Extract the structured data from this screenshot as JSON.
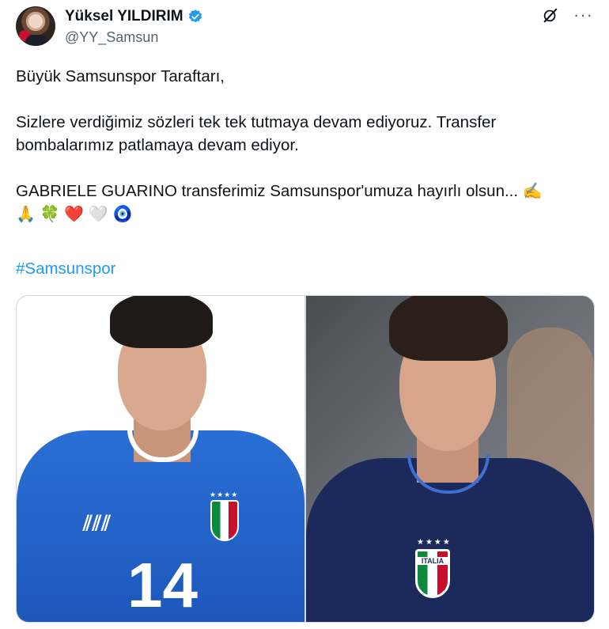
{
  "author": {
    "name": "Yüksel YILDIRIM",
    "handle": "@YY_Samsun",
    "verified": true,
    "avatar_icon": "profile-photo"
  },
  "header_actions": {
    "grok_icon": "grok-icon",
    "more_label": "···"
  },
  "tweet": {
    "line1": "Büyük Samsunspor Taraftarı,",
    "line2": "Sizlere verdiğimiz sözleri tek tek tutmaya devam ediyoruz. Transfer",
    "line3": "bombalarımız patlamaya devam ediyor.",
    "line4": "GABRIELE GUARINO transferimiz Samsunspor'umuza hayırlı olsun... ",
    "line4_emoji": "✍️",
    "line5_emojis": [
      "🙏",
      "🍀",
      "❤️",
      "🤍",
      "🧿"
    ],
    "hashtag": "#Samsunspor"
  },
  "media": {
    "left_photo": {
      "jersey_number": "14",
      "brand_mark": "adidas"
    },
    "right_photo": {
      "crest_label": "ITALIA"
    }
  },
  "colors": {
    "link": "#1d9bf0",
    "verified": "#1d9bf0",
    "text": "#0f1419",
    "muted": "#536471"
  }
}
